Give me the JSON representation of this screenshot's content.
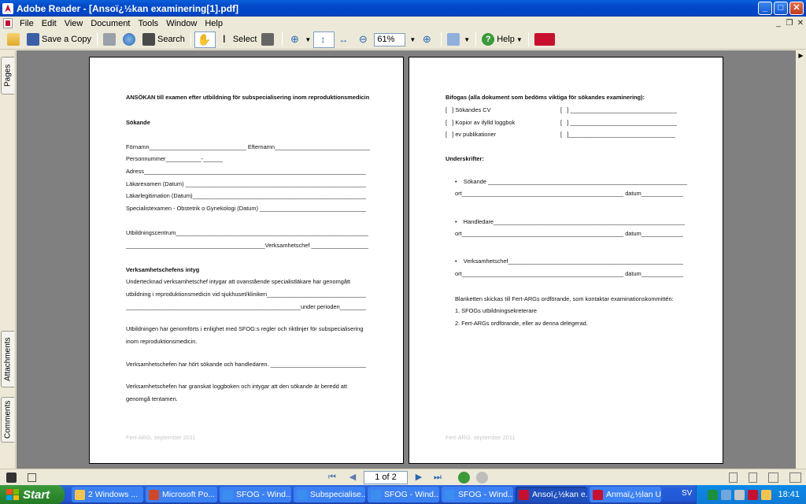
{
  "window": {
    "title": "Adobe Reader - [Ansoï¿½kan examinering[1].pdf]"
  },
  "menu": [
    "File",
    "Edit",
    "View",
    "Document",
    "Tools",
    "Window",
    "Help"
  ],
  "toolbar": {
    "save_copy": "Save a Copy",
    "search": "Search",
    "select": "Select",
    "zoom_value": "61%",
    "help": "Help"
  },
  "nav_tabs": {
    "pages": "Pages",
    "attachments": "Attachments",
    "comments": "Comments"
  },
  "page1": {
    "heading": "ANSÖKAN till examen efter utbildning för subspecialisering inom reproduktionsmedicin",
    "sokande_head": "Sökande",
    "fornamn": "Förnamn______________________________ Efternamn_________________________________",
    "personnummer": "Personnummer___________-______",
    "adress": "Adress____________________________________________________________________________",
    "lakarexamen": "Läkarexamen (Datum) ________________________________________________________________",
    "lakarleg": "Läkarlegitimation (Datum)____________________________________________________________",
    "specialist": "Specialistexamen - Obstetrik o Gynekologi (Datum) _____________________________________",
    "utbcentrum": "Utbildningscentrum___________________________________________________________________",
    "verkchef_line": "___________________________________________Verksamhetschef ________________________________",
    "intyg_head": "Verksamhetschefens intyg",
    "intyg1": "Undertecknad verksamhetschef intygar att ovanstående specialistläkare har genomgått",
    "intyg2": "utbildning i reproduktionsmedicin vid sjukhuset/kliniken__________________________________",
    "intyg3": "______________________________________________________under perioden_____________-___________",
    "sfog1": "Utbildningen har genomförts i enlighet med SFOG:s regler och riktlinjer för subspecialisering",
    "sfog2": "inom reproduktionsmedicin.",
    "hort": "Verksamhetschefen har hört sökande och handledaren. ________________________________",
    "granskat1": "Verksamhetschefen har granskat loggboken och intygar att den sökande är beredd att",
    "granskat2": "genomgå tentamen.",
    "footer": "Fert-ARG, september 2011"
  },
  "page2": {
    "bifogas": "Bifogas (alla dokument som bedöms viktiga för sökandes examinering):",
    "att1": "[   ] Sökandes CV",
    "att2": "[   ] Kopior av ifylld loggbok",
    "att3": "[   ] ev publikationer",
    "box1": "[   ] _________________________________",
    "box2": "[   ] _________________________________",
    "box3": "[   ]_________________________________",
    "underskrifter": "Underskrifter:",
    "sig1": "•    Sökande ______________________________________________________________________",
    "ort1": "ort__________________________________________________ datum_____________________________",
    "sig2": "•    Handledare____________________________________________________________________",
    "ort2": "ort__________________________________________________ datum_____________________________",
    "sig3": "•    Verksamhetschef________________________________________________________________",
    "ort3": "ort__________________________________________________ datum_____________________________",
    "blanketten": "Blanketten skickas till Fert-ARGs ordförande, som kontaktar examinationskommittén:",
    "item1": "1. SFOGs utbildningsekreterare",
    "item2": "2. Fert-ARGs ordförande, eller av denna delegerad.",
    "footer": "Fert-ARG, september 2011"
  },
  "status": {
    "page_indicator": "1 of 2"
  },
  "taskbar": {
    "start": "Start",
    "tasks": [
      {
        "label": "2 Windows ...",
        "color": "#f3c34b"
      },
      {
        "label": "Microsoft Po...",
        "color": "#d24726"
      },
      {
        "label": "SFOG - Wind...",
        "color": "#3b8df0"
      },
      {
        "label": "Subspecialise...",
        "color": "#3b8df0"
      },
      {
        "label": "SFOG - Wind...",
        "color": "#3b8df0"
      },
      {
        "label": "SFOG - Wind...",
        "color": "#3b8df0"
      },
      {
        "label": "Ansoï¿½kan e...",
        "color": "#c8102e"
      },
      {
        "label": "Anmaï¿½lan Ut...",
        "color": "#c8102e"
      }
    ],
    "language": "SV",
    "clock": "18:41"
  }
}
